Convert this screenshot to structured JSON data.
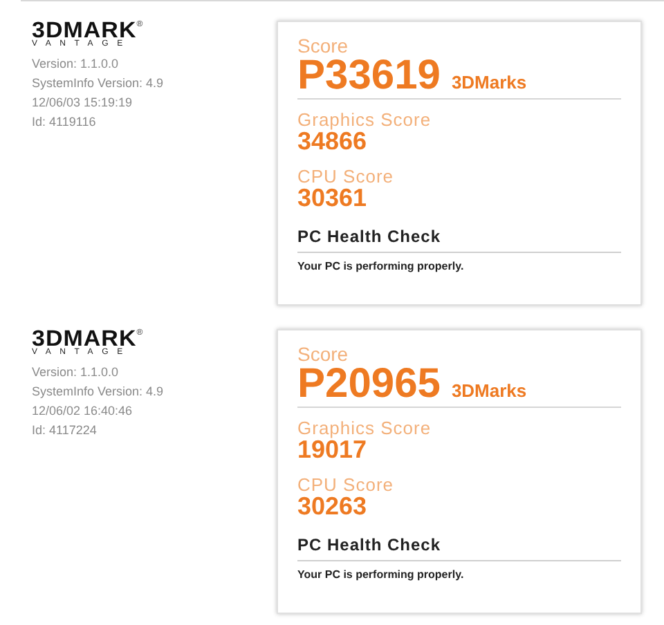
{
  "results": [
    {
      "logo": {
        "wordmark": "3DMARK",
        "registered": "®",
        "subtitle": "VANTAGE"
      },
      "info": [
        "Version: 1.1.0.0",
        "SystemInfo Version: 4.9",
        "12/06/03 15:19:19",
        "Id: 4119116"
      ],
      "score_label": "Score",
      "score": "P33619",
      "score_unit": "3DMarks",
      "graphics_label": "Graphics Score",
      "graphics_score": "34866",
      "cpu_label": "CPU Score",
      "cpu_score": "30361",
      "health_title": "PC Health Check",
      "health_message": "Your PC is performing properly."
    },
    {
      "logo": {
        "wordmark": "3DMARK",
        "registered": "®",
        "subtitle": "VANTAGE"
      },
      "info": [
        "Version: 1.1.0.0",
        "SystemInfo Version: 4.9",
        "12/06/02 16:40:46",
        "Id: 4117224"
      ],
      "score_label": "Score",
      "score": "P20965",
      "score_unit": "3DMarks",
      "graphics_label": "Graphics Score",
      "graphics_score": "19017",
      "cpu_label": "CPU Score",
      "cpu_score": "30263",
      "health_title": "PC Health Check",
      "health_message": "Your PC is performing properly."
    }
  ]
}
